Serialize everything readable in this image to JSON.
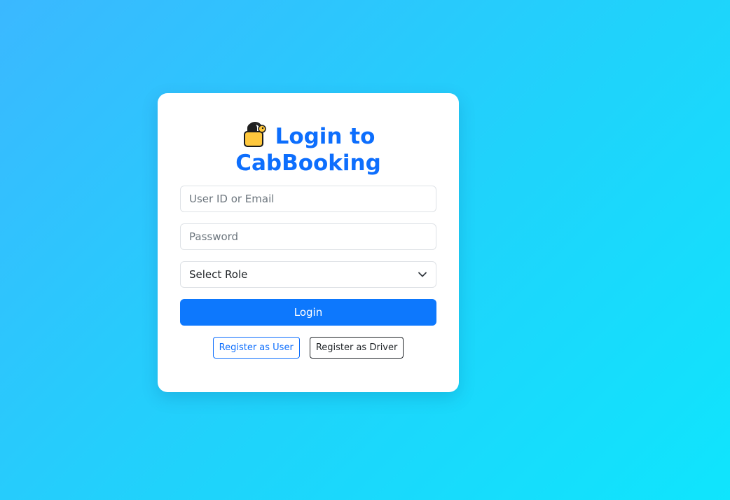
{
  "login": {
    "title_line1": "Login to",
    "title_line2": "CabBooking",
    "title_icon": "lock-icon",
    "user_field_placeholder": "User ID or Email",
    "password_field_placeholder": "Password",
    "role_select_value": "Select Role",
    "login_button_label": "Login",
    "register_user_label": "Register as User",
    "register_driver_label": "Register as Driver"
  },
  "colors": {
    "accent": "#0d6efd",
    "background_start": "#3bb8ff",
    "background_end": "#0fe5fd"
  }
}
